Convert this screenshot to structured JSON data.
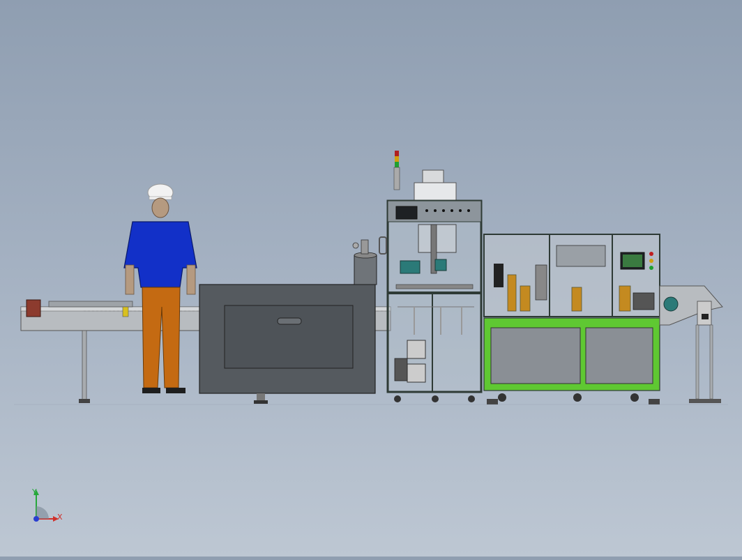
{
  "viewport": {
    "background_top": "#8f9eb1",
    "background_bottom": "#bdc7d3"
  },
  "triad": {
    "x_label": "X",
    "y_label": "Y",
    "x_color": "#d0302a",
    "y_color": "#26a83a",
    "z_color": "#2a3fd0"
  },
  "colors": {
    "shirt": "#1230c8",
    "pants": "#c46a12",
    "helmet": "#f2f2f2",
    "frame_green": "#5fc832",
    "frame_dark": "#2e3a35",
    "enclosure": "#555a5f",
    "panel_grey": "#8a8f95",
    "conveyor": "#b8bcc0"
  }
}
